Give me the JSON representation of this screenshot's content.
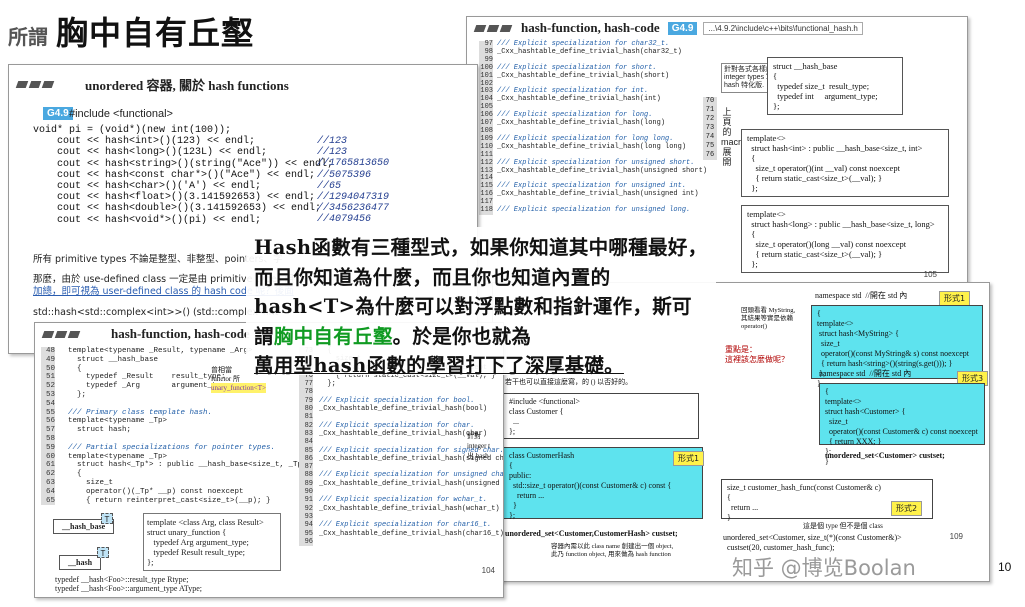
{
  "header": {
    "small": "所謂",
    "big": "胸中自有丘壑"
  },
  "slide1": {
    "title": "unordered 容器, 關於 hash functions",
    "tag": "G4.9",
    "include": "#include <functional>",
    "code": [
      "void* pi = (void*)(new int(100));",
      "    cout << hash<int>()(123) << endl;",
      "    cout << hash<long>()(123L) << endl;",
      "    cout << hash<string>()(string(\"Ace\")) << endl;",
      "    cout << hash<const char*>()(\"Ace\") << endl;",
      "    cout << hash<char>()('A') << endl;",
      "    cout << hash<float>()(3.141592653) << endl;",
      "    cout << hash<double>()(3.141592653) << endl;",
      "    cout << hash<void*>()(pi) << endl;"
    ],
    "comments": [
      "//123",
      "//123",
      "//1765813650",
      "//5075396",
      "//65",
      "//1294047319",
      "//3456236477",
      "//4079456"
    ],
    "para1": "所有 primitive types 不論是整型、非整型、pointers、字",
    "para2": "那麼，由於 use-defined class 一定是由 primitive types 組",
    "para3": "加總，即可視為 user-defined class 的 hash code 呢？後面",
    "para4": "std::hash<std::complex<int>>() (std::complex<int"
  },
  "slide2": {
    "title": "hash-function, hash-code",
    "tag": "G4.9",
    "path": "...\\4.9.2\\include\\c++\\bits\\functional_hash.h",
    "line_numbers": [
      "97",
      "98",
      "99",
      "100",
      "101",
      "102",
      "103",
      "104",
      "105",
      "106",
      "107",
      "108",
      "109",
      "110",
      "111",
      "112",
      "113",
      "114",
      "115",
      "116",
      "117",
      "118"
    ],
    "code": [
      "/// Explicit specialization for char32_t.",
      "_Cxx_hashtable_define_trivial_hash(char32_t)",
      "",
      "/// Explicit specialization for short.",
      "_Cxx_hashtable_define_trivial_hash(short)",
      "",
      "/// Explicit specialization for int.",
      "_Cxx_hashtable_define_trivial_hash(int)",
      "",
      "/// Explicit specialization for long.",
      "_Cxx_hashtable_define_trivial_hash(long)",
      "",
      "/// Explicit specialization for long long.",
      "_Cxx_hashtable_define_trivial_hash(long long)",
      "",
      "/// Explicit specialization for unsigned short.",
      "_Cxx_hashtable_define_trivial_hash(unsigned short)",
      "",
      "/// Explicit specialization for unsigned int.",
      "_Cxx_hashtable_define_trivial_hash(unsigned int)",
      "",
      "/// Explicit specialization for unsigned long."
    ],
    "callout": "針對各式各樣的 integer types 寫出 hash 特化版.",
    "mini_lines": [
      "70",
      "71",
      "72",
      "73",
      "74",
      "75",
      "76"
    ],
    "vlabel": "上頁的 macro 展開",
    "base_box": "struct __hash_base\n{\n  typedef size_t  result_type;\n  typedef int     argument_type;\n};",
    "int_box": "template<>\n  struct hash<int> : public __hash_base<size_t, int>\n  {\n    size_t operator()(int __val) const noexcept\n    { return static_cast<size_t>(__val); }\n  };",
    "long_box": "template<>\n  struct hash<long> : public __hash_base<size_t, long>\n  {\n    size_t operator()(long __val) const noexcept\n    { return static_cast<size_t>(__val); }\n  };",
    "page": "105"
  },
  "slide3": {
    "title": "hash-function, hash-code",
    "line_numbers": [
      "48",
      "49",
      "50",
      "51",
      "52",
      "53",
      "54",
      "55",
      "56",
      "57",
      "58",
      "59",
      "60",
      "61",
      "62",
      "63",
      "64",
      "65"
    ],
    "code": [
      "  template<typename _Result, typename _Arg>",
      "    struct __hash_base",
      "    {",
      "      typedef _Result    result_type;",
      "      typedef _Arg       argument_type;",
      "    };",
      "",
      "  /// Primary class template hash.",
      "  template<typename _Tp>",
      "    struct hash;",
      "",
      "  /// Partial specializations for pointer types.",
      "  template<typename _Tp>",
      "    struct hash<_Tp*> : public __hash_base<size_t, _Tp*>",
      "    {",
      "      size_t",
      "      operator()(_Tp* __p) const noexcept",
      "      { return reinterpret_cast<size_t>(__p); }"
    ],
    "note1": "曾相當",
    "note2": "functor 所",
    "unary": "unary_function<T>",
    "hash_base": "__hash_base",
    "hash": "__hash",
    "t": "T",
    "tmpl_box": "template <class Arg, class Result>\nstruct unary_function {\n   typedef Arg argument_type;\n   typedef Result result_type;\n};",
    "typedef1": "typedef __hash<Foo>::result_type Rtype;",
    "typedef2": "typedef __hash<Foo>::argument_type AType;",
    "line_numbers2": [
      "73",
      "74",
      "75",
      "76",
      "77",
      "78",
      "79",
      "80",
      "81",
      "82",
      "83",
      "84",
      "85",
      "86",
      "87",
      "88",
      "89",
      "90",
      "91",
      "92",
      "93",
      "94",
      "95",
      "96"
    ],
    "code2": [
      "  {",
      "    size_t",
      "    operator()(_Tp __val) const noexcept",
      "    { return static_cast<size_t>(__val); }",
      "  };",
      "",
      "/// Explicit specialization for bool.",
      "_Cxx_hashtable_define_trivial_hash(bool)",
      "",
      "/// Explicit specialization for char.",
      "_Cxx_hashtable_define_trivial_hash(char)",
      "",
      "/// Explicit specialization for signed char.",
      "_Cxx_hashtable_define_trivial_hash(signed char)",
      "",
      "/// Explicit specialization for unsigned char.",
      "_Cxx_hashtable_define_trivial_hash(unsigned char)",
      "",
      "/// Explicit specialization for wchar_t.",
      "_Cxx_hashtable_define_trivial_hash(wchar_t)",
      "",
      "/// Explicit specialization for char16_t.",
      "_Cxx_hashtable_define_trivial_hash(char16_t)",
      ""
    ],
    "side_note": "針對 integer t 出 hash",
    "page": "104"
  },
  "slide4": {
    "ns1": "namespace std  //開在 std 內",
    "form1": "形式1",
    "box1": "{\ntemplate<>\n struct hash<MyString> {\n  size_t\n  operator()(const MyString& s) const noexcept\n  { return hash<string>()(string(s.get())); }\n };\n}",
    "note_left": "回頭看看 MyString,\n其結果等實是依賴\noperator()",
    "key_note": "重點是：\n這裡該怎麼做呢？",
    "intro": "若干也可以直接這麼寫，的 () 以否好的。",
    "include": "#include <functional>\nclass Customer {\n  ...\n};",
    "form_a": "形式1",
    "box_customer": "class CustomerHash\n{\npublic:\n  std::size_t operator()(const Customer& c) const {\n    return ...\n  }\n};",
    "uset1": "unordered_set<Customer,CustomerHash> custset;",
    "note_bottom": "容器內需以此 class name 創建出一個 object,\n此乃 function object, 用來做為 hash function",
    "ns3": "namespace std  //開在 std 內",
    "form3": "形式3",
    "box3": "{\ntemplate<>\nstruct hash<Customer> {\n  size_t\n  operator()(const Customer& c) const noexcept\n  { return XXX; }\n};\n}",
    "uset3": "unordered_set<Customer> custset;",
    "func_box": "size_t customer_hash_func(const Customer& c)\n{\n  return ...\n}",
    "form2": "形式2",
    "uset2": "unordered_set<Customer, size_t(*)(const Customer&)>\n  custset(20, customer_hash_func);",
    "type_note": "這是個 type 但不是個 class",
    "page": "109"
  },
  "overlay": {
    "p1": "Hash函數有三種型式，如果你知道其中哪種最好，而且你知道為什麼，而且你也知道內置的hash<T>為什麼可以對浮點數和指針運作，斯可謂",
    "green": "胸中自有丘壑",
    "p2": "。於是你也就為",
    "p3": "萬用型hash函數的學習打下了深厚基礎。"
  },
  "watermark": "知乎 @博览Boolan",
  "page_number": "10"
}
